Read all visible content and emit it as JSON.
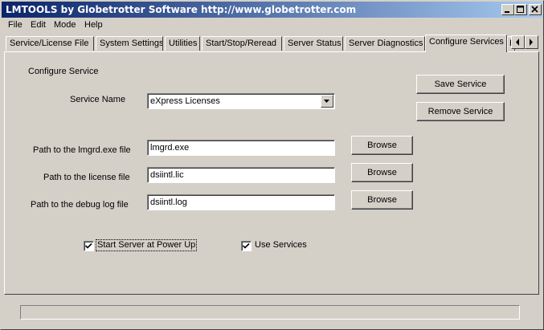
{
  "window": {
    "title": "LMTOOLS by Globetrotter Software http://www.globetrotter.com"
  },
  "title_buttons": {
    "minimize": "minimize-icon",
    "maximize": "maximize-icon",
    "close": "close-icon"
  },
  "menu": {
    "items": [
      "File",
      "Edit",
      "Mode",
      "Help"
    ]
  },
  "tabs": {
    "items": [
      "Service/License File",
      "System Settings",
      "Utilities",
      "Start/Stop/Reread",
      "Server Status",
      "Server Diagnostics",
      "Configure Services",
      "B"
    ],
    "active": "Configure Services"
  },
  "configure": {
    "section_title": "Configure Service",
    "service_name_label": "Service Name",
    "service_name_value": "eXpress Licenses",
    "save_button": "Save Service",
    "remove_button": "Remove Service",
    "lmgrd_label": "Path to the lmgrd.exe file",
    "lmgrd_value": "lmgrd.exe",
    "license_label": "Path to the license file",
    "license_value": "dsiintl.lic",
    "debug_label": "Path to the debug log file",
    "debug_value": "dsiintl.log",
    "browse_label": "Browse",
    "start_server_label": "Start Server at Power Up",
    "start_server_checked": true,
    "use_services_label": "Use Services",
    "use_services_checked": true
  },
  "status": {
    "text": ""
  }
}
